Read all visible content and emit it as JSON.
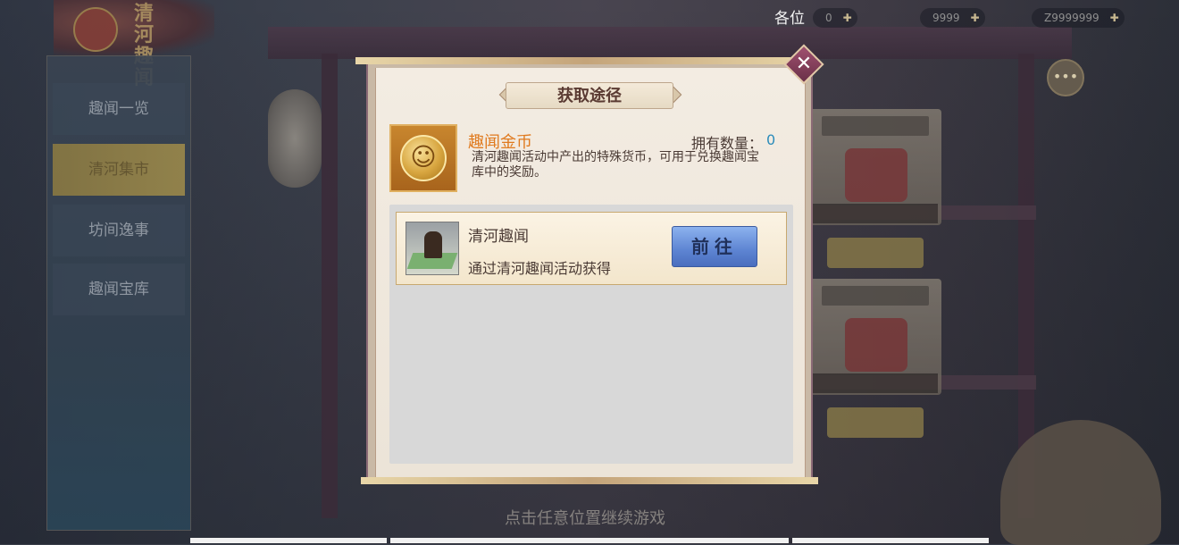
{
  "top_bar": {
    "title": "各位",
    "notice": "",
    "resources": [
      {
        "label": "0",
        "icon": "gold-icon"
      },
      {
        "label": "9999",
        "icon": "gem-icon"
      },
      {
        "label": "Z9999999",
        "icon": "token-icon"
      }
    ]
  },
  "logo": {
    "text": "清河趣闻"
  },
  "left_nav": {
    "items": [
      {
        "label": "趣闻一览",
        "active": false
      },
      {
        "label": "清河集市",
        "active": true
      },
      {
        "label": "坊间逸事",
        "active": false
      },
      {
        "label": "趣闻宝库",
        "active": false
      }
    ]
  },
  "background_shop": {
    "cards": [
      {
        "label": "",
        "caption": ""
      },
      {
        "label": "",
        "caption": ""
      }
    ],
    "prices": [
      "",
      ""
    ]
  },
  "modal": {
    "title": "获取途径",
    "close_icon": "close-icon",
    "item": {
      "name": "趣闻金币",
      "owned_label": "拥有数量：",
      "owned_value": "0",
      "description": "清河趣闻活动中产出的特殊货币，可用于兑换趣闻宝库中的奖励。",
      "icon": "gold-coin-icon"
    },
    "sources": [
      {
        "name": "清河趣闻",
        "description": "通过清河趣闻活动获得",
        "button_label": "前往",
        "icon": "event-scene-icon"
      }
    ]
  },
  "hint": "点击任意位置继续游戏",
  "colors": {
    "item_name": "#e07a1e",
    "owned_value": "#2c8cba",
    "go_button": "#5d84d2",
    "close_button": "#a05070"
  }
}
